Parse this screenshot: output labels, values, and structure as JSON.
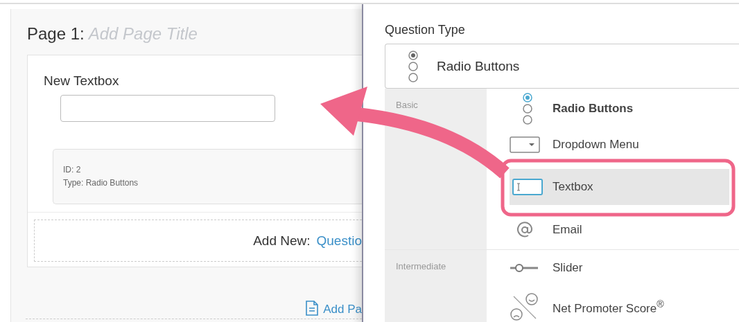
{
  "page": {
    "label": "Page 1:",
    "title_placeholder": "Add Page Title"
  },
  "question": {
    "title": "New Textbox",
    "info": [
      "ID: 2",
      "Type: Radio Buttons"
    ]
  },
  "add_new": {
    "label": "Add New:",
    "link": "Questio"
  },
  "add_page": {
    "link": "Add Pa"
  },
  "question_type": {
    "label": "Question Type",
    "value": "Radio Buttons"
  },
  "categories": [
    {
      "name": "Basic",
      "items": [
        {
          "label": "Radio Buttons",
          "kind": "radio",
          "current": true,
          "hovered": false
        },
        {
          "label": "Dropdown Menu",
          "kind": "dropdown",
          "current": false,
          "hovered": false
        },
        {
          "label": "Textbox",
          "kind": "textbox",
          "current": false,
          "hovered": true
        },
        {
          "label": "Email",
          "kind": "email",
          "current": false,
          "hovered": false
        }
      ]
    },
    {
      "name": "Intermediate",
      "items": [
        {
          "label": "Slider",
          "kind": "slider",
          "current": false,
          "hovered": false
        },
        {
          "label": "Net Promoter Score$^{®}$",
          "kind": "nps",
          "current": false,
          "hovered": false
        }
      ]
    }
  ]
}
